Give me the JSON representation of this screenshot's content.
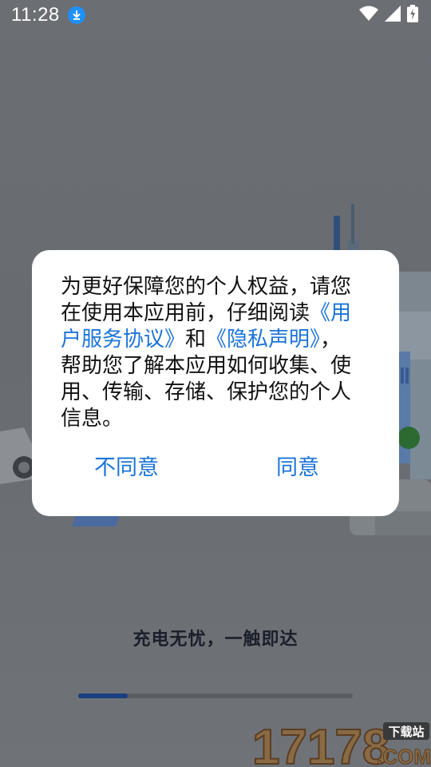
{
  "status_bar": {
    "time": "11:28",
    "download_icon": "download-icon",
    "wifi_icon": "wifi-icon",
    "signal_icon": "signal-icon",
    "battery_icon": "battery-charging-icon"
  },
  "dialog": {
    "text_before": "为更好保障您的个人权益，请您在使用本应用前，仔细阅读",
    "link_user_agreement": "《用户服务协议》",
    "text_and": "和",
    "link_privacy": "《隐私声明》",
    "text_after": "，帮助您了解本应用如何收集、使用、传输、存储、保护您的个人信息。",
    "disagree_label": "不同意",
    "agree_label": "同意"
  },
  "splash": {
    "slogan": "充电无忧，一触即达",
    "progress": 0.18
  },
  "watermark": {
    "number": "17178",
    "tag": "下载站",
    "domain": ".COM"
  },
  "colors": {
    "link": "#1a73d9",
    "progress": "#1a3f80",
    "download_badge": "#1e90ff"
  }
}
